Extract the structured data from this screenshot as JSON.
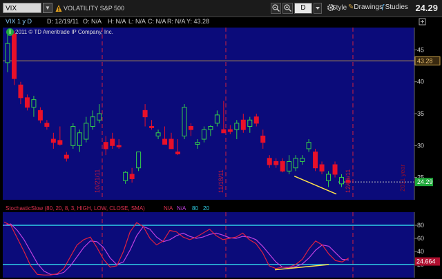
{
  "toolbar": {
    "symbol": "VIX",
    "description": "VOLATILITY S&P 500",
    "aggregation": "D",
    "style_label": "Style",
    "drawings_label": "Drawings",
    "studies_label": "Studies",
    "last_price": "24.29"
  },
  "info_bar": {
    "chart_name": "VIX 1 y D",
    "date": "D: 12/19/11",
    "open": "O: N/A",
    "high": "H: N/A",
    "low": "L: N/A",
    "close": "C: N/A",
    "range": "R: N/A",
    "y": "Y: 43.28"
  },
  "copyright": "2011 © TD Ameritrade IP Company, Inc.",
  "price_axis": {
    "ticks": [
      "45",
      "40",
      "35",
      "30",
      "25"
    ],
    "crosshair_label": "43.28",
    "last_label": "24.29",
    "year_label": "2011 year"
  },
  "date_markers": [
    "10/21/11",
    "11/18/11",
    "12/16/11"
  ],
  "stochastic": {
    "title": "StochasticSlow (80, 20, 8, 3, HIGH, LOW, CLOSE, SMA)",
    "na1": "N/A",
    "na2": "N/A",
    "overbought": "80",
    "oversold": "20",
    "axis_ticks": [
      "80",
      "60",
      "40",
      "20"
    ],
    "value_label": "24.664"
  },
  "colors": {
    "background": "#000000",
    "plot_area": "#0b0b7a",
    "up_candle": "#35d04a",
    "down_candle": "#e8102a",
    "crosshair": "#c8a048",
    "period_marker": "#d02040",
    "trendline": "#ffe14a",
    "stoch_k": "#e02040",
    "stoch_d": "#c040e0",
    "stoch_levels": "#30d0e8"
  },
  "chart_data": {
    "type": "candlestick",
    "y_range": [
      21.5,
      48.5
    ],
    "crosshair_y": 43.28,
    "last_price": 24.29,
    "candles": [
      {
        "o": 43.0,
        "h": 48.2,
        "l": 41.5,
        "c": 46.0
      },
      {
        "o": 47.5,
        "h": 48.0,
        "l": 39.5,
        "c": 40.5
      },
      {
        "o": 39.5,
        "h": 40.0,
        "l": 36.5,
        "c": 37.5
      },
      {
        "o": 37.5,
        "h": 38.0,
        "l": 35.5,
        "c": 36.0
      },
      {
        "o": 36.0,
        "h": 37.8,
        "l": 34.5,
        "c": 37.2
      },
      {
        "o": 35.5,
        "h": 36.0,
        "l": 33.5,
        "c": 34.0
      },
      {
        "o": 33.5,
        "h": 34.0,
        "l": 32.5,
        "c": 33.0
      },
      {
        "o": 31.0,
        "h": 32.0,
        "l": 29.5,
        "c": 30.5
      },
      {
        "o": 30.8,
        "h": 33.0,
        "l": 30.0,
        "c": 30.2
      },
      {
        "o": 28.5,
        "h": 29.0,
        "l": 27.5,
        "c": 28.0
      },
      {
        "o": 30.0,
        "h": 33.5,
        "l": 29.5,
        "c": 33.0
      },
      {
        "o": 30.0,
        "h": 32.5,
        "l": 29.0,
        "c": 32.0
      },
      {
        "o": 31.0,
        "h": 34.5,
        "l": 30.5,
        "c": 33.5
      },
      {
        "o": 33.0,
        "h": 35.5,
        "l": 32.5,
        "c": 34.5
      },
      {
        "o": 34.0,
        "h": 36.5,
        "l": 33.5,
        "c": 35.0
      },
      {
        "o": 30.5,
        "h": 31.5,
        "l": 28.5,
        "c": 29.5
      },
      {
        "o": 31.0,
        "h": 32.0,
        "l": 29.5,
        "c": 30.0
      },
      {
        "o": 30.0,
        "h": 31.0,
        "l": 29.5,
        "c": 29.8
      },
      {
        "o": 24.5,
        "h": 26.0,
        "l": 24.0,
        "c": 25.8
      },
      {
        "o": 25.5,
        "h": 26.5,
        "l": 24.2,
        "c": 24.8
      },
      {
        "o": 26.5,
        "h": 29.0,
        "l": 26.0,
        "c": 29.0
      },
      {
        "o": 35.5,
        "h": 36.5,
        "l": 33.0,
        "c": 34.5
      },
      {
        "o": 33.0,
        "h": 34.0,
        "l": 32.5,
        "c": 32.8
      },
      {
        "o": 31.5,
        "h": 32.5,
        "l": 31.0,
        "c": 32.0
      },
      {
        "o": 31.0,
        "h": 33.0,
        "l": 30.5,
        "c": 30.2
      },
      {
        "o": 31.0,
        "h": 32.0,
        "l": 29.5,
        "c": 29.5
      },
      {
        "o": 29.0,
        "h": 31.0,
        "l": 28.5,
        "c": 28.7
      },
      {
        "o": 31.5,
        "h": 36.5,
        "l": 31.0,
        "c": 36.0
      },
      {
        "o": 33.0,
        "h": 33.5,
        "l": 31.5,
        "c": 32.5
      },
      {
        "o": 30.2,
        "h": 31.0,
        "l": 29.5,
        "c": 30.5
      },
      {
        "o": 31.0,
        "h": 33.0,
        "l": 30.5,
        "c": 32.5
      },
      {
        "o": 32.5,
        "h": 33.2,
        "l": 31.5,
        "c": 33.0
      },
      {
        "o": 33.5,
        "h": 35.5,
        "l": 33.0,
        "c": 34.8
      },
      {
        "o": 32.5,
        "h": 37.0,
        "l": 32.0,
        "c": 32.0
      },
      {
        "o": 32.5,
        "h": 33.2,
        "l": 31.8,
        "c": 32.2
      },
      {
        "o": 32.5,
        "h": 34.0,
        "l": 31.0,
        "c": 33.5
      },
      {
        "o": 34.0,
        "h": 35.0,
        "l": 32.0,
        "c": 32.5
      },
      {
        "o": 33.0,
        "h": 34.5,
        "l": 32.0,
        "c": 34.0
      },
      {
        "o": 34.5,
        "h": 35.0,
        "l": 33.0,
        "c": 33.5
      },
      {
        "o": 31.5,
        "h": 32.5,
        "l": 29.5,
        "c": 30.5
      },
      {
        "o": 28.0,
        "h": 28.5,
        "l": 26.5,
        "c": 27.0
      },
      {
        "o": 27.5,
        "h": 28.0,
        "l": 26.5,
        "c": 27.0
      },
      {
        "o": 27.5,
        "h": 28.0,
        "l": 25.8,
        "c": 26.0
      },
      {
        "o": 26.0,
        "h": 28.5,
        "l": 25.5,
        "c": 27.5
      },
      {
        "o": 26.5,
        "h": 28.5,
        "l": 26.0,
        "c": 28.0
      },
      {
        "o": 27.5,
        "h": 28.5,
        "l": 27.0,
        "c": 28.0
      },
      {
        "o": 29.5,
        "h": 31.0,
        "l": 29.0,
        "c": 30.5
      },
      {
        "o": 29.0,
        "h": 29.5,
        "l": 26.0,
        "c": 26.5
      },
      {
        "o": 27.0,
        "h": 27.5,
        "l": 25.5,
        "c": 26.0
      },
      {
        "o": 24.5,
        "h": 26.0,
        "l": 23.5,
        "c": 25.5
      },
      {
        "o": 27.0,
        "h": 27.5,
        "l": 25.0,
        "c": 25.5
      },
      {
        "o": 24.0,
        "h": 25.5,
        "l": 23.5,
        "c": 25.0
      },
      {
        "o": 24.5,
        "h": 25.0,
        "l": 23.8,
        "c": 24.3
      }
    ],
    "stoch_range": [
      0,
      100
    ],
    "stoch_k": [
      85,
      80,
      60,
      40,
      18,
      5,
      4,
      4,
      6,
      14,
      32,
      50,
      58,
      62,
      46,
      28,
      16,
      18,
      40,
      70,
      84,
      78,
      60,
      50,
      56,
      72,
      70,
      62,
      58,
      62,
      68,
      74,
      64,
      58,
      60,
      62,
      68,
      58,
      52,
      38,
      18,
      14,
      16,
      16,
      20,
      28,
      44,
      56,
      50,
      36,
      26,
      24,
      30
    ],
    "stoch_d": [
      80,
      82,
      72,
      58,
      40,
      22,
      10,
      5,
      5,
      8,
      18,
      32,
      46,
      56,
      55,
      46,
      30,
      20,
      24,
      42,
      64,
      78,
      74,
      62,
      55,
      58,
      64,
      68,
      63,
      60,
      62,
      66,
      68,
      65,
      61,
      60,
      63,
      62,
      58,
      48,
      36,
      24,
      16,
      15,
      17,
      21,
      30,
      42,
      50,
      48,
      38,
      28,
      27
    ]
  }
}
